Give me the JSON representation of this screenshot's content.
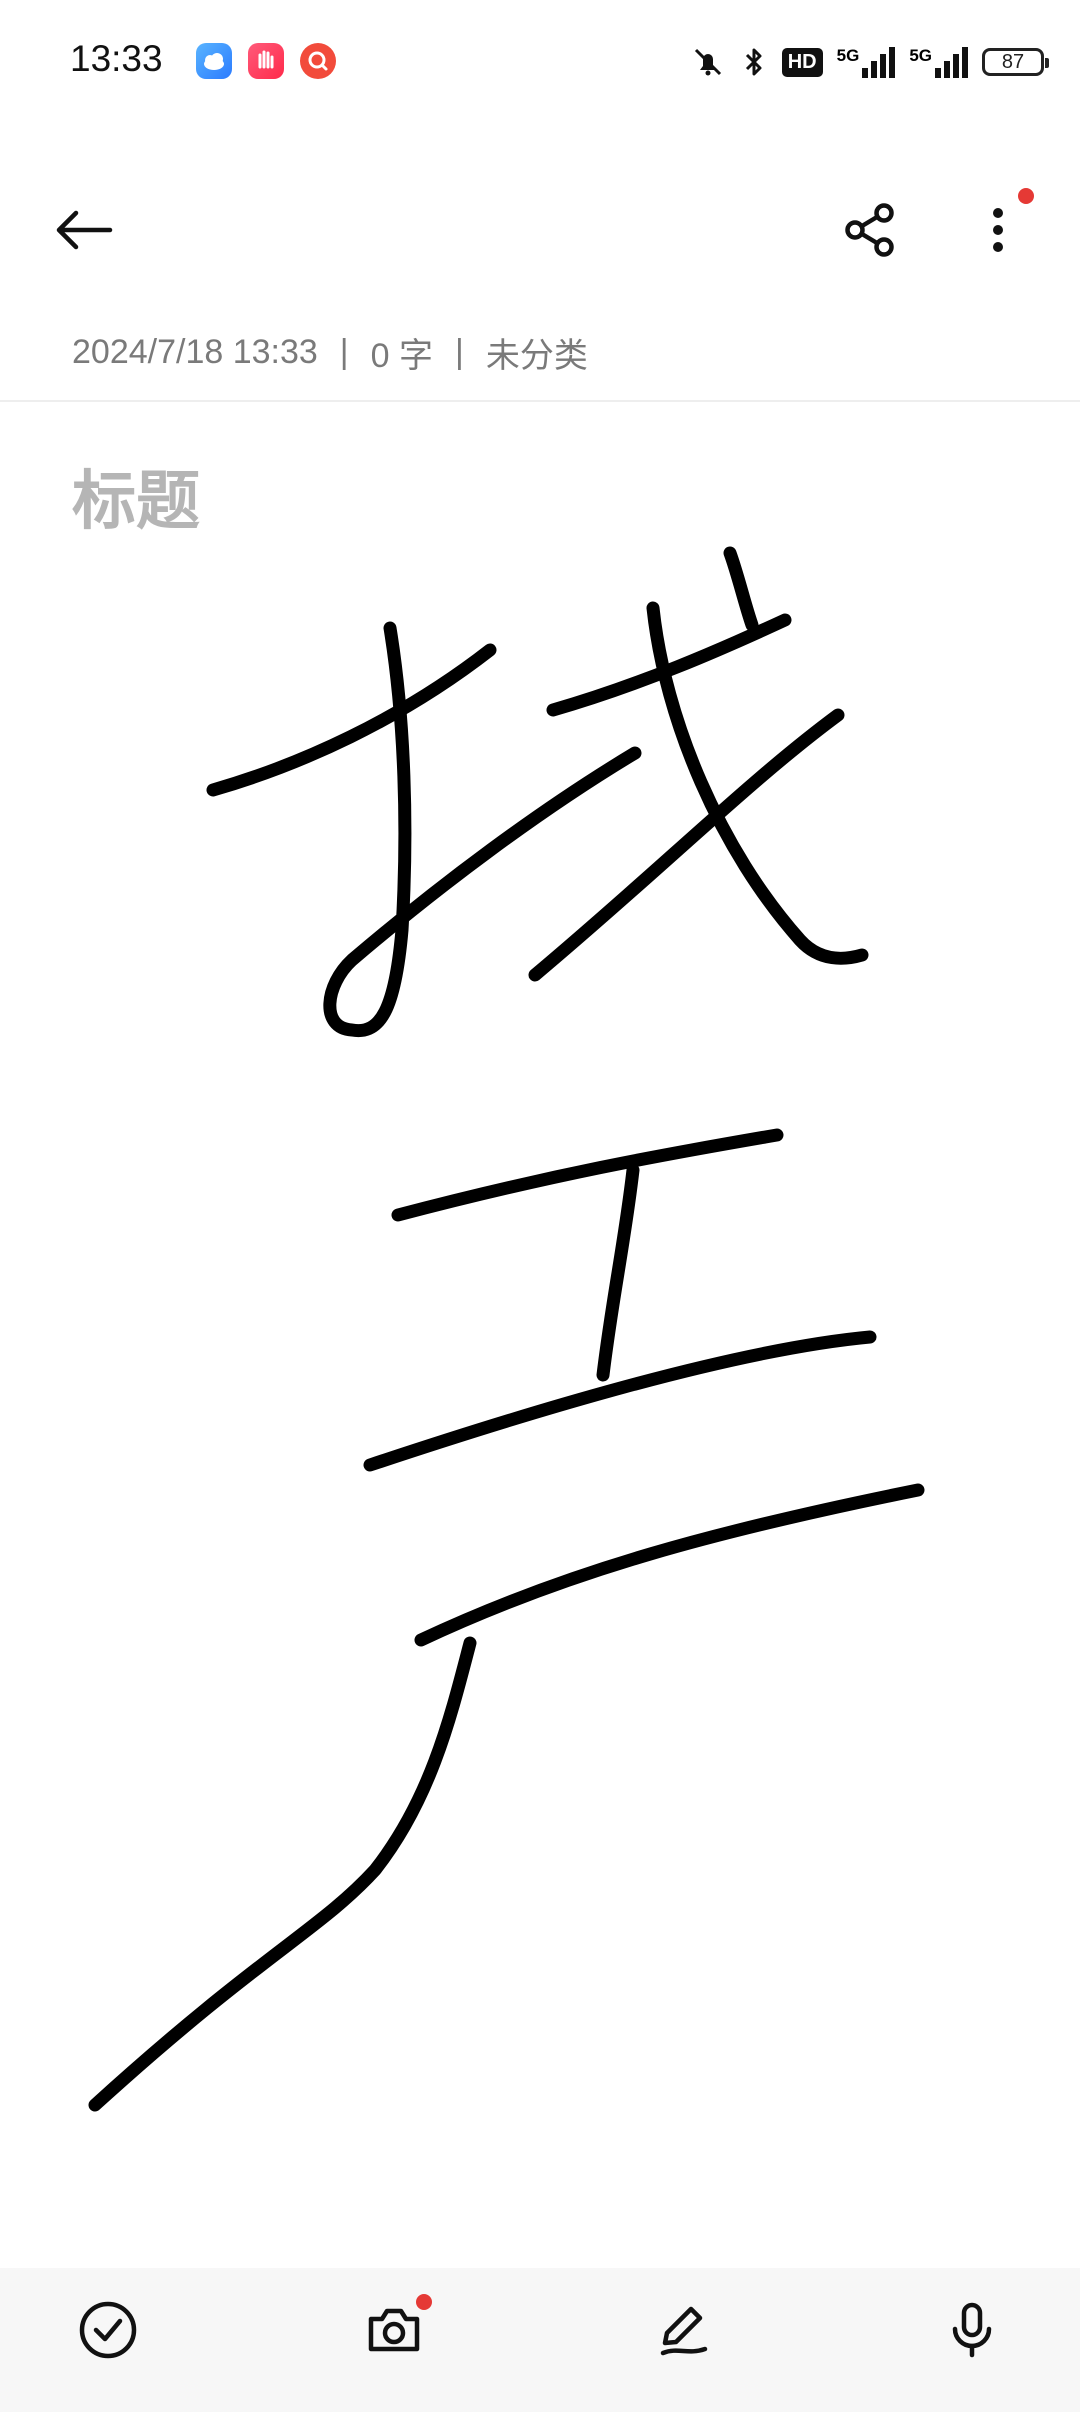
{
  "status_bar": {
    "time": "13:33",
    "battery": "87",
    "network_1": "5G",
    "network_2": "5G",
    "hd_label": "HD"
  },
  "note": {
    "date": "2024/7/18 13:33",
    "word_count": "0 字",
    "category": "未分类",
    "separator": "|",
    "title_placeholder": "标题"
  },
  "colors": {
    "accent_red": "#e53935",
    "ink": "#000000",
    "meta_text": "#7a7a7a"
  },
  "icons": {
    "back": "arrow-left-icon",
    "share": "share-icon",
    "more": "more-vertical-icon",
    "done": "check-circle-icon",
    "camera": "camera-icon",
    "pen": "pen-icon",
    "mic": "mic-icon"
  }
}
